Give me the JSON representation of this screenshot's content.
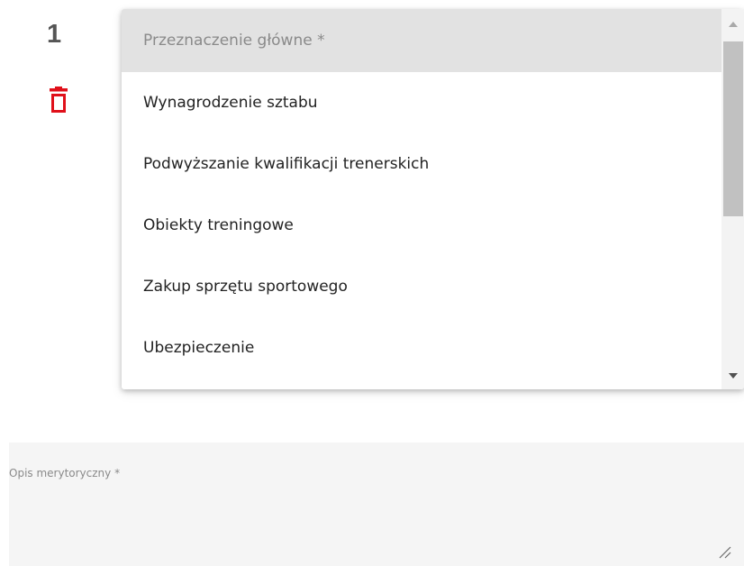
{
  "row": {
    "number": "1"
  },
  "colors": {
    "delete_icon": "#e0101a",
    "placeholder_bg": "#e2e2e2",
    "textarea_bg": "#f5f5f5"
  },
  "icons": {
    "delete": "trash-icon",
    "resize": "resize-handle-icon",
    "scroll_up": "caret-up-icon",
    "scroll_down": "caret-down-icon"
  },
  "dropdown": {
    "placeholder": "Przeznaczenie główne *",
    "options": [
      "Wynagrodzenie sztabu",
      "Podwyższanie kwalifikacji trenerskich",
      "Obiekty treningowe",
      "Zakup sprzętu sportowego",
      "Ubezpieczenie"
    ]
  },
  "description_field": {
    "label": "Opis merytoryczny *",
    "value": ""
  }
}
